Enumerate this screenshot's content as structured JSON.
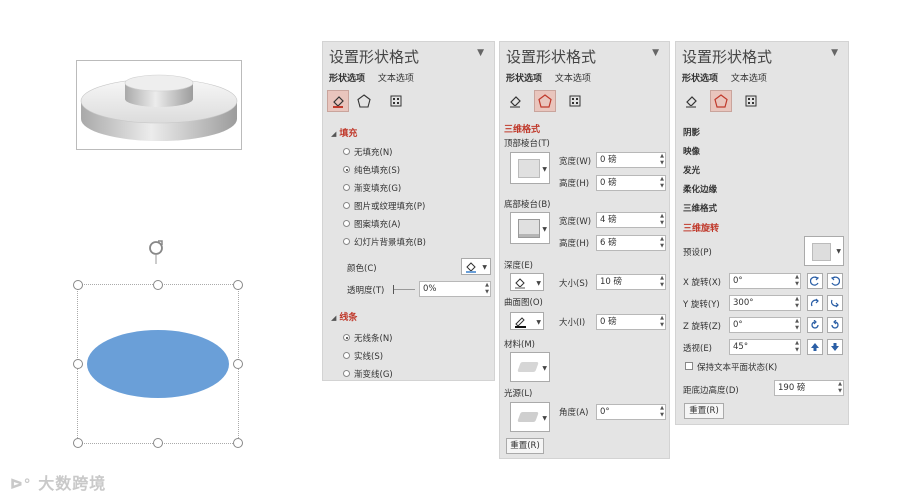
{
  "panels": [
    {
      "title": "设置形状格式",
      "tabs": [
        "形状选项",
        "文本选项"
      ],
      "fill_section": "填充",
      "fill_options": [
        "无填充(N)",
        "纯色填充(S)",
        "渐变填充(G)",
        "图片或纹理填充(P)",
        "图案填充(A)",
        "幻灯片背景填充(B)"
      ],
      "fill_selected": 1,
      "color_label": "颜色(C)",
      "transparency_label": "透明度(T)",
      "transparency_value": "0%",
      "line_section": "线条",
      "line_options": [
        "无线条(N)",
        "实线(S)",
        "渐变线(G)"
      ],
      "line_selected": 0
    },
    {
      "title": "设置形状格式",
      "tabs": [
        "形状选项",
        "文本选项"
      ],
      "section": "三维格式",
      "top_bevel_label": "顶部棱台(T)",
      "width_label": "宽度(W)",
      "height_label": "高度(H)",
      "top_width": "0 磅",
      "top_height": "0 磅",
      "bottom_bevel_label": "底部棱台(B)",
      "bottom_width": "4 磅",
      "bottom_height": "6 磅",
      "depth_label": "深度(E)",
      "size_label": "大小(S)",
      "depth_value": "10 磅",
      "contour_label": "曲面图(O)",
      "contour_size_label": "大小(I)",
      "contour_value": "0 磅",
      "material_label": "材料(M)",
      "lighting_label": "光源(L)",
      "angle_label": "角度(A)",
      "angle_value": "0°",
      "reset_label": "重置(R)"
    },
    {
      "title": "设置形状格式",
      "tabs": [
        "形状选项",
        "文本选项"
      ],
      "sections": [
        "阴影",
        "映像",
        "发光",
        "柔化边缘",
        "三维格式",
        "三维旋转"
      ],
      "active_section": 5,
      "preset_label": "预设(P)",
      "x_label": "X 旋转(X)",
      "x_value": "0°",
      "y_label": "Y 旋转(Y)",
      "y_value": "300°",
      "z_label": "Z 旋转(Z)",
      "z_value": "0°",
      "perspective_label": "透视(E)",
      "perspective_value": "45°",
      "keep_flat_label": "保持文本平面状态(K)",
      "distance_label": "距底边高度(D)",
      "distance_value": "190 磅",
      "reset_label": "重置(R)"
    }
  ],
  "watermark": "大数跨境",
  "colors": {
    "accent": "#c0392b",
    "ellipse": "#6a9fd8"
  }
}
